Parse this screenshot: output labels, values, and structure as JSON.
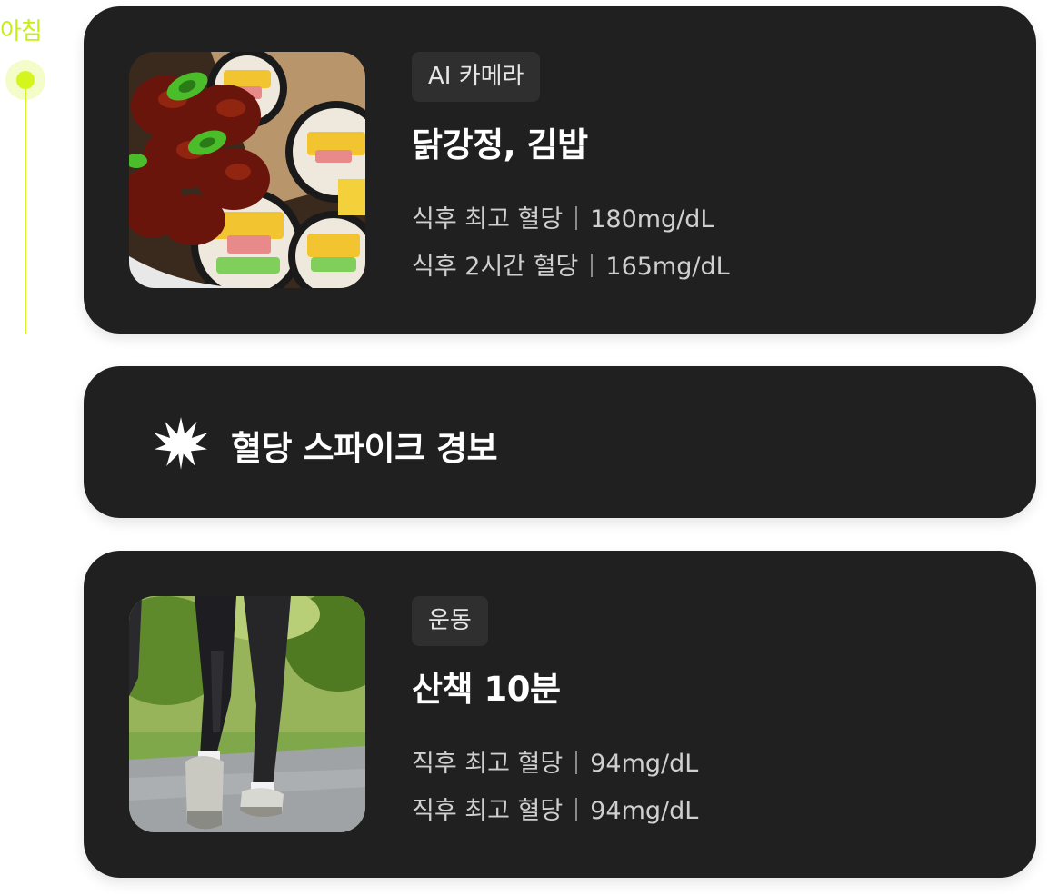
{
  "timeline": {
    "label": "아침",
    "accent_color": "#d4f51e"
  },
  "meal_card": {
    "image_icon": "food-photo",
    "tag": "AI 카메라",
    "title": "닭강정, 김밥",
    "stats": [
      {
        "label": "식후 최고 혈당",
        "value": "180mg/dL"
      },
      {
        "label": "식후 2시간 혈당",
        "value": "165mg/dL"
      }
    ]
  },
  "alert_card": {
    "icon": "starburst-icon",
    "text": "혈당 스파이크 경보"
  },
  "exercise_card": {
    "image_icon": "walking-photo",
    "tag": "운동",
    "title": "산책 10분",
    "stats": [
      {
        "label": "직후 최고 혈당",
        "value": "94mg/dL"
      },
      {
        "label": "직후 최고 혈당",
        "value": "94mg/dL"
      }
    ]
  },
  "colors": {
    "card_bg": "#202020",
    "tag_bg": "#2f2f2f",
    "accent": "#d4f51e"
  }
}
